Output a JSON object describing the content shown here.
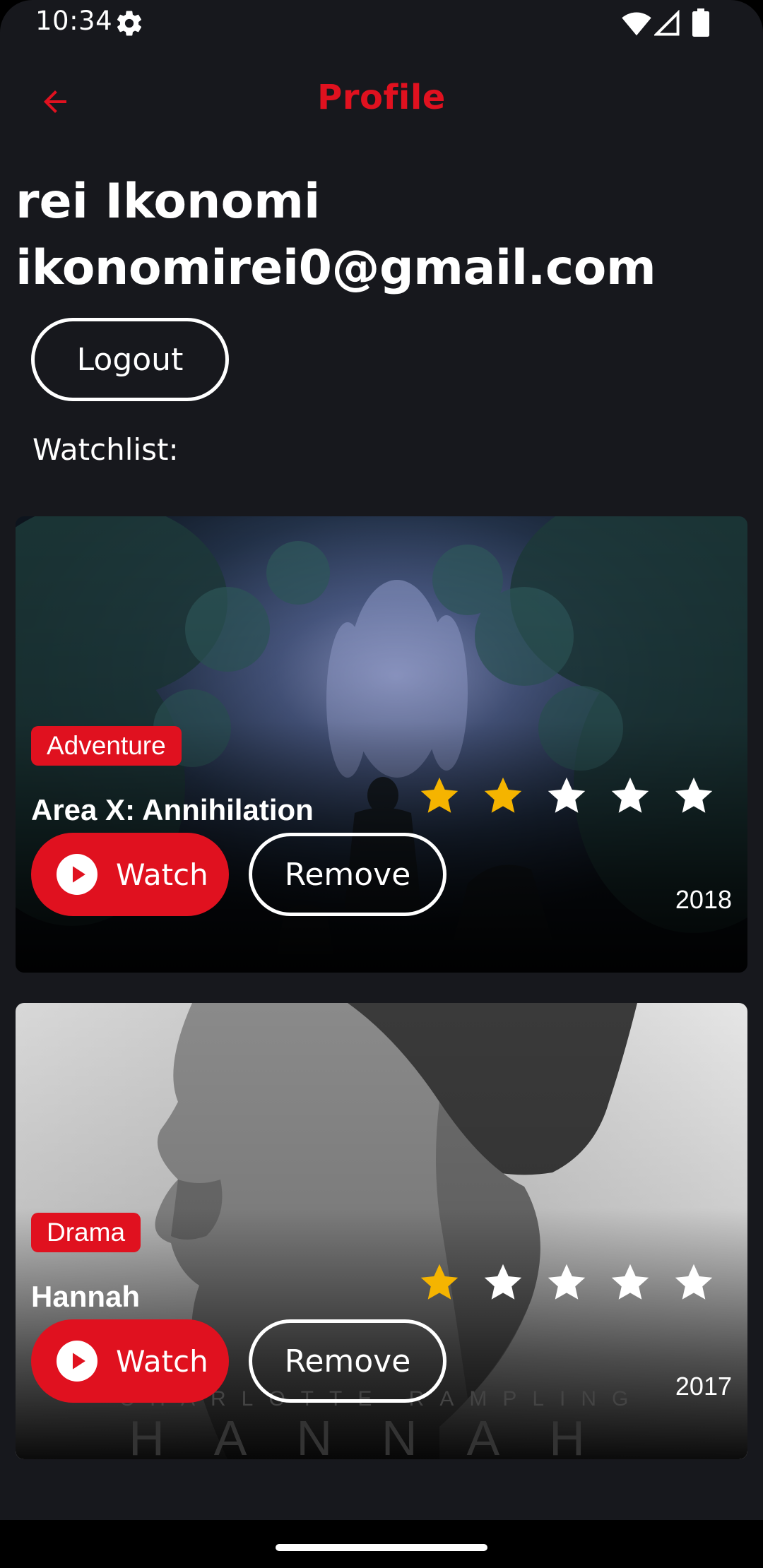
{
  "status_bar": {
    "time": "10:34",
    "icons": [
      "settings-icon",
      "wifi-icon",
      "signal-icon",
      "battery-icon"
    ]
  },
  "app_bar": {
    "back_icon": "arrow-left-icon",
    "title": "Profile"
  },
  "profile": {
    "name": "rei Ikonomi",
    "email": "ikonomirei0@gmail.com",
    "logout_label": "Logout",
    "watchlist_label": "Watchlist:"
  },
  "watchlist": [
    {
      "genre": "Adventure",
      "title": "Area X: Annihilation",
      "rating": 2,
      "max_rating": 5,
      "year": "2018",
      "watch_label": "Watch",
      "remove_label": "Remove"
    },
    {
      "genre": "Drama",
      "title": "Hannah",
      "rating": 1,
      "max_rating": 5,
      "year": "2017",
      "watch_label": "Watch",
      "remove_label": "Remove"
    }
  ],
  "colors": {
    "accent": "#e0111f",
    "background": "#17181d",
    "star_filled": "#f5b400",
    "star_empty": "#ffffff"
  }
}
